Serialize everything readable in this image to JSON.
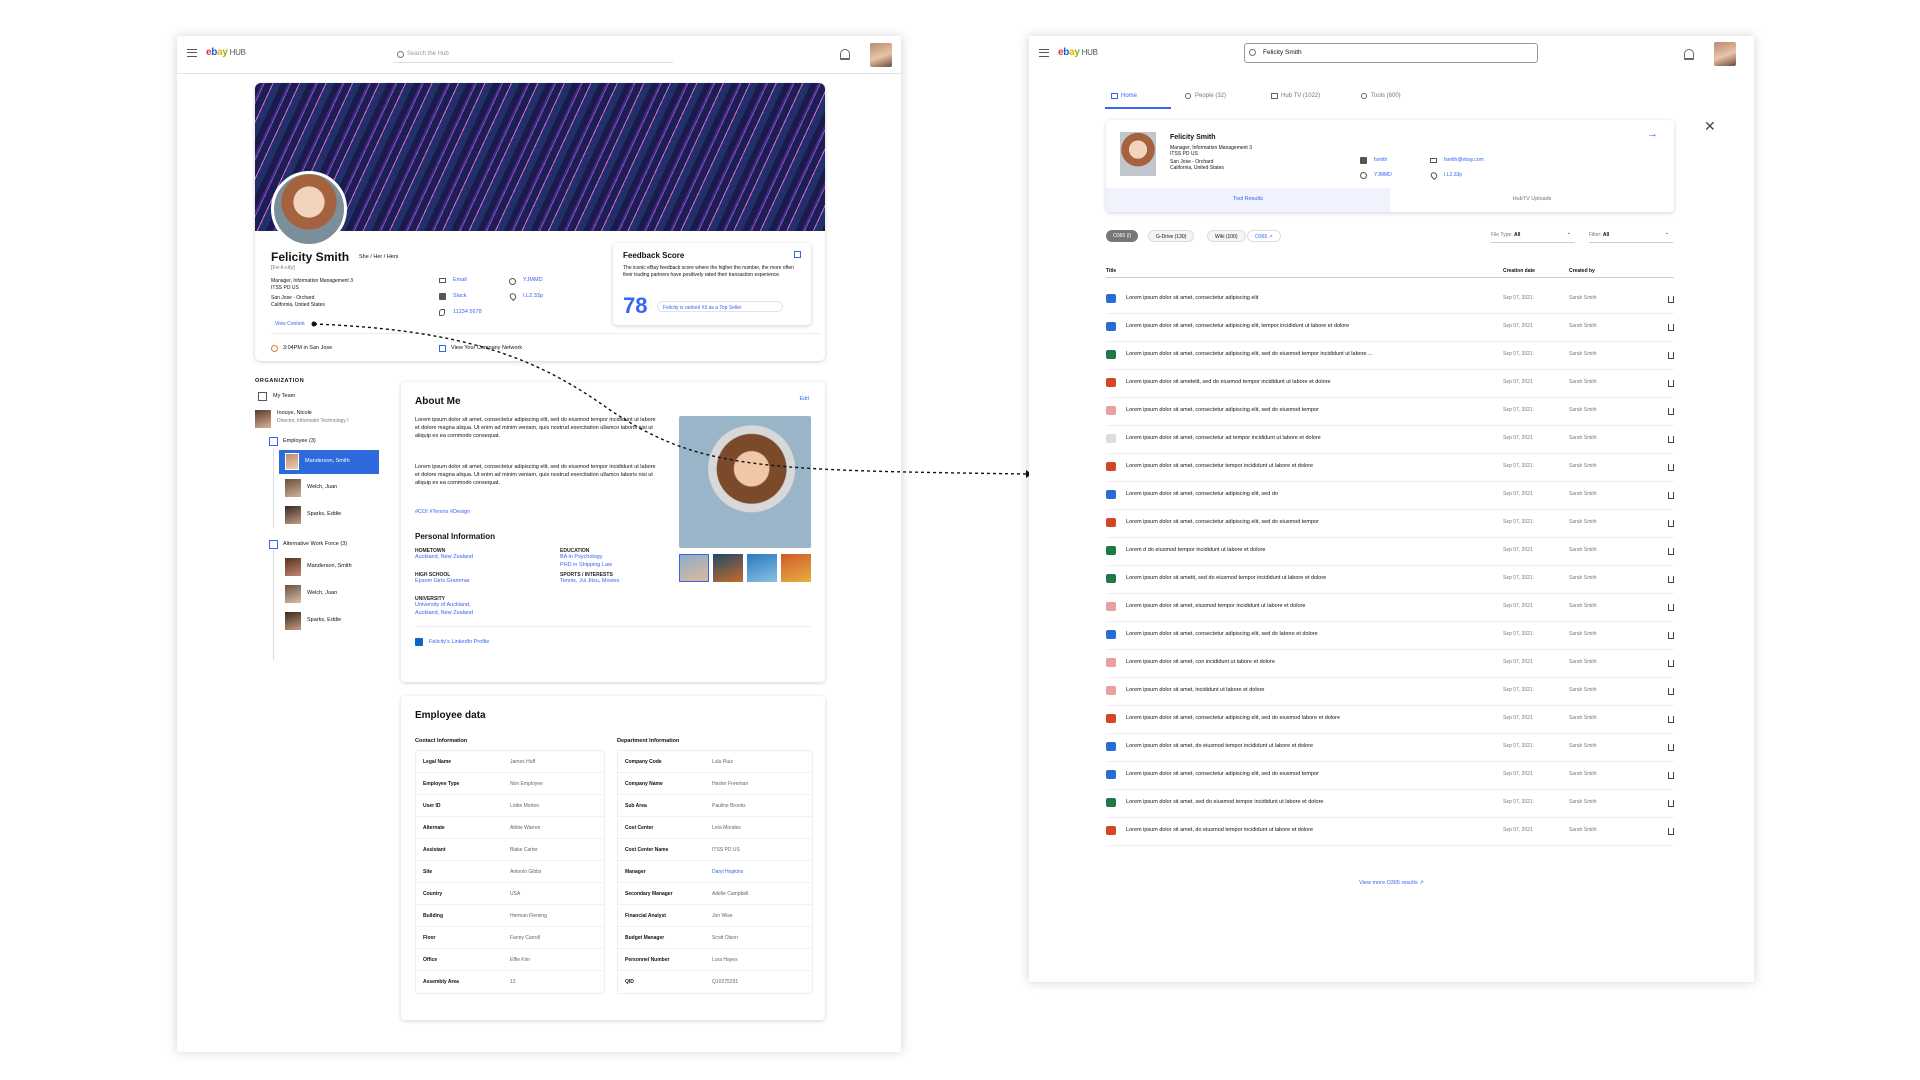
{
  "left": {
    "app": {
      "search_placeholder": "Search the Hub",
      "logo_hub": "HUB"
    },
    "profile": {
      "name": "Felicity Smith",
      "pronouns": "She / Her / Hers",
      "pronunciation": "[Fe-li-city]",
      "title_line1": "Manager, Information Management 3",
      "title_line2": "ITSS PD US",
      "location_line1": "San Jose - Orchard",
      "location_line2": "California, United States",
      "view_content": "View Content",
      "email": "Email",
      "slack": "Slack",
      "phone": "11234 5678",
      "id": "YJMMD",
      "building": "I.L2.33p",
      "local_time": "3:04PM in San Jose",
      "company_view": "View Your Company Network"
    },
    "feedback": {
      "title": "Feedback Score",
      "description": "The iconic eBay feedback score where the higher the number, the more often their trading partners have positively rated their transaction experience.",
      "score": "78",
      "rank": "Felicity is ranked #3 as a Top Seller"
    },
    "organization": {
      "heading": "ORGANIZATION",
      "my_team": "My Team",
      "manager_name": "Inouye, Nicole",
      "manager_title": "Director, Informatin Technology I",
      "group1": "Employee (3)",
      "group1_members": [
        "Manderson, Smith",
        "Welch, Juan",
        "Sparks, Eddie"
      ],
      "group2": "Alternative Work Force (3)",
      "group2_members": [
        "Manderson, Smith",
        "Welch, Juan",
        "Sparks, Eddie"
      ]
    },
    "about": {
      "title": "About Me",
      "edit": "Edit",
      "para1": "Lorem ipsum dolor sit amet, consectetur adipiscing elit, sed do eiusmod tempor incididunt ut labore et dolore magna aliqua. Ut enim ad minim veniam, quis nostrud exercitation ullamco laboris nisi ut aliquip ex ea commodo consequat.",
      "para2": "Lorem ipsum dolor sit amet, consectetur adipiscing elit, sed do eiusmod tempor incididunt ut labore et dolore magna aliqua. Ut enim ad minim veniam, quis nostrud exercitation ullamco laboris nisi ut aliquip ex ea commodo consequat.",
      "tags": "#COI #Tennis #Design",
      "personal_title": "Personal Information",
      "hometown_label": "HOMETOWN",
      "hometown": "Auckland, New Zealand",
      "highschool_label": "HIGH SCHOOL",
      "highschool": "Epsom Girls Grammar",
      "university_label": "UNIVERSITY",
      "university1": "University of Auckland,",
      "university2": "Auckland, New Zealand",
      "education_label": "EDUCATION",
      "education1": "BA in Psychology",
      "education2": "PHD in Shipping Law",
      "sports_label": "SPORTS / INTERESTS",
      "sports": "Tennis, Jui Jitsu, Movies",
      "linkedin": "Felicity's LinkedIn Profile"
    },
    "employee": {
      "title": "Employee data",
      "contact_heading": "Contact Information",
      "dept_heading": "Department Information",
      "contact_rows": [
        [
          "Legal Name",
          "James Huff"
        ],
        [
          "Employee Type",
          "Non Employee"
        ],
        [
          "User ID",
          "Lottie Morton"
        ],
        [
          "Alternate",
          "Abbie Warren"
        ],
        [
          "Assistant",
          "Blake Carter"
        ],
        [
          "Site",
          "Antonio Gibbs"
        ],
        [
          "Country",
          "USA"
        ],
        [
          "Building",
          "Herman Fleming"
        ],
        [
          "Floor",
          "Fanny Carroll"
        ],
        [
          "Office",
          "Effie Kim"
        ],
        [
          "Assembly Area",
          "12"
        ]
      ],
      "dept_rows": [
        [
          "Company Code",
          "Lulu Ruiz"
        ],
        [
          "Company Name",
          "Hester Freeman"
        ],
        [
          "Sub Area",
          "Pauline Brooks"
        ],
        [
          "Cost Center",
          "Leta Morales"
        ],
        [
          "Cost Center Name",
          "ITSS PD US"
        ],
        [
          "Manager",
          "Daryl Hopkins"
        ],
        [
          "Secondary Manager",
          "Adelle Campbell"
        ],
        [
          "Financial Analyst",
          "Jon Wise"
        ],
        [
          "Budget Manager",
          "Scott Olson"
        ],
        [
          "Personnel Number",
          "Lura Hayes"
        ],
        [
          "QID",
          "Q10275291"
        ]
      ]
    }
  },
  "right": {
    "search_value": "Felicity Smith",
    "logo_hub": "HUB",
    "tabs": [
      "Home",
      "People (32)",
      "Hub TV (1022)",
      "Tools (600)"
    ],
    "person": {
      "name": "Felicity Smith",
      "title1": "Manager, Information Management 3",
      "title2": "ITSS PD US",
      "loc1": "San Jose - Orchard",
      "loc2": "California, United States",
      "handle": "fsmith",
      "id": "YJMMD",
      "email": "fsmith@ebay.com",
      "building": "I.L2.33p"
    },
    "subtabs": [
      "Tool Results",
      "HubTV Uploads"
    ],
    "chips": [
      "O365 (l)",
      "G-Drive (130)",
      "Wiki (100)",
      "O365"
    ],
    "filetype_label": "File Type:",
    "filetype_value": "All",
    "filter_label": "Filter:",
    "filter_value": "All",
    "columns": [
      "Title",
      "Creation date",
      "Created by"
    ],
    "rows": [
      {
        "title": "Lorem ipsum dolor sit amet, consectetur adipiscing elit",
        "date": "Sep 07, 2021",
        "by": "Sarah Smith",
        "icon": "word",
        "color": "#2b6cd4"
      },
      {
        "title": "Lorem ipsum dolor sit amet, consectetur adipiscing elit, tempor incididunt ut labore et dolore",
        "date": "Sep 07, 2021",
        "by": "Sarah Smith",
        "icon": "word",
        "color": "#2b6cd4"
      },
      {
        "title": "Lorem ipsum dolor sit amet, consectetur adipiscing elit, sed do eiusmod tempor incididunt ut labore ...",
        "date": "Sep 07, 2021",
        "by": "Sarah Smith",
        "icon": "excel",
        "color": "#1e7a44"
      },
      {
        "title": "Lorem ipsum dolor sit ametelit, sed do eiusmod tempor incididunt ut labore et dolore",
        "date": "Sep 07, 2021",
        "by": "Sarah Smith",
        "icon": "powerpoint",
        "color": "#d24726"
      },
      {
        "title": "Lorem ipsum dolor sit amet, consectetur adipiscing elit, sed do eiusmod tempor",
        "date": "Sep 07, 2021",
        "by": "Sarah Smith",
        "icon": "pdf",
        "color": "#e8a0a0"
      },
      {
        "title": "Lorem ipsum dolor sit amet, consectetur ad tempor incididunt ut labore et dolore",
        "date": "Sep 07, 2021",
        "by": "Sarah Smith",
        "icon": "file",
        "color": "#dddddd"
      },
      {
        "title": "Lorem ipsum dolor sit amet, consectetur  tempor incididunt ut labore et dolore",
        "date": "Sep 07, 2021",
        "by": "Sarah Smith",
        "icon": "powerpoint",
        "color": "#d24726"
      },
      {
        "title": "Lorem ipsum dolor sit amet, consectetur adipiscing elit, sed do",
        "date": "Sep 07, 2021",
        "by": "Sarah Smith",
        "icon": "word",
        "color": "#2b6cd4"
      },
      {
        "title": "Lorem ipsum dolor sit amet, consectetur adipiscing elit, sed do eiusmod tempor",
        "date": "Sep 07, 2021",
        "by": "Sarah Smith",
        "icon": "powerpoint",
        "color": "#d24726"
      },
      {
        "title": "Lorem d do eiusmod tempor incididunt ut labore et dolore",
        "date": "Sep 07, 2021",
        "by": "Sarah Smith",
        "icon": "excel",
        "color": "#1e7a44"
      },
      {
        "title": "Lorem ipsum dolor sit ametit, sed do eiusmod tempor incididunt ut labore et dolore",
        "date": "Sep 07, 2021",
        "by": "Sarah Smith",
        "icon": "excel",
        "color": "#1e7a44"
      },
      {
        "title": "Lorem ipsum dolor sit amet,  eiusmod tempor incididunt ut labore et dolore",
        "date": "Sep 07, 2021",
        "by": "Sarah Smith",
        "icon": "pdf",
        "color": "#e8a0a0"
      },
      {
        "title": "Lorem ipsum dolor sit amet, consectetur adipiscing elit, sed do labore et dolore",
        "date": "Sep 07, 2021",
        "by": "Sarah Smith",
        "icon": "word",
        "color": "#2b6cd4"
      },
      {
        "title": "Lorem ipsum dolor sit amet, con incididunt ut labore et dolore",
        "date": "Sep 07, 2021",
        "by": "Sarah Smith",
        "icon": "pdf",
        "color": "#e8a0a0"
      },
      {
        "title": "Lorem ipsum dolor sit amet,  incididunt ut labore et dolore",
        "date": "Sep 07, 2021",
        "by": "Sarah Smith",
        "icon": "pdf",
        "color": "#e8a0a0"
      },
      {
        "title": "Lorem ipsum dolor sit amet, consectetur adipiscing elit, sed do eiusmod  labore et dolore",
        "date": "Sep 07, 2021",
        "by": "Sarah Smith",
        "icon": "powerpoint",
        "color": "#d24726"
      },
      {
        "title": "Lorem ipsum dolor sit amet,  do eiusmod tempor incididunt ut labore et dolore",
        "date": "Sep 07, 2021",
        "by": "Sarah Smith",
        "icon": "word",
        "color": "#2b6cd4"
      },
      {
        "title": "Lorem ipsum dolor sit amet, consectetur adipiscing elit, sed do eiusmod tempor",
        "date": "Sep 07, 2021",
        "by": "Sarah Smith",
        "icon": "word",
        "color": "#2b6cd4"
      },
      {
        "title": "Lorem ipsum dolor sit amet, sed do eiusmod tempor incididunt ut labore et dolore",
        "date": "Sep 07, 2021",
        "by": "Sarah Smith",
        "icon": "excel",
        "color": "#1e7a44"
      },
      {
        "title": "Lorem ipsum dolor sit amet, do eiusmod tempor incididunt ut labore et dolore",
        "date": "Sep 07, 2021",
        "by": "Sarah Smith",
        "icon": "powerpoint",
        "color": "#d24726"
      }
    ],
    "view_more": "View more O365 results"
  },
  "colors": {
    "accent": "#3665f3",
    "selected": "#2d6bdd"
  }
}
